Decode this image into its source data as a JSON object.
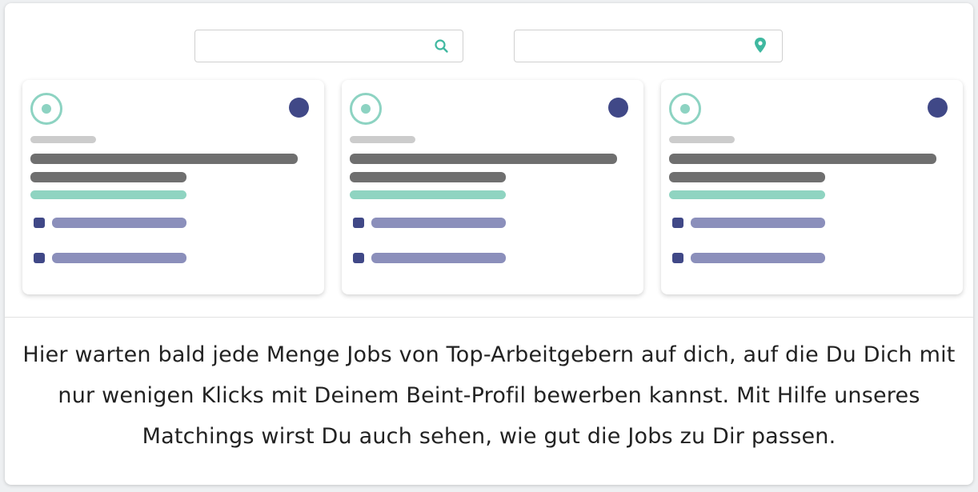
{
  "search": {
    "query_placeholder": "",
    "location_placeholder": "",
    "search_icon": "search-icon",
    "location_icon": "location-pin-icon"
  },
  "colors": {
    "accent_teal": "#8dd3c2",
    "pin_teal": "#3fb8a0",
    "navy": "#404887",
    "placeholder_gray": "#6f6f6f",
    "placeholder_purple": "#8b8fbb"
  },
  "cards": [
    {
      "id": 1
    },
    {
      "id": 2
    },
    {
      "id": 3
    }
  ],
  "description": "Hier warten bald jede Menge Jobs von Top-Arbeitgebern auf dich, auf die Du Dich mit nur wenigen Klicks mit Deinem Beint-Profil bewerben kannst. Mit Hilfe unseres Matchings wirst Du auch sehen, wie gut die Jobs zu Dir passen."
}
